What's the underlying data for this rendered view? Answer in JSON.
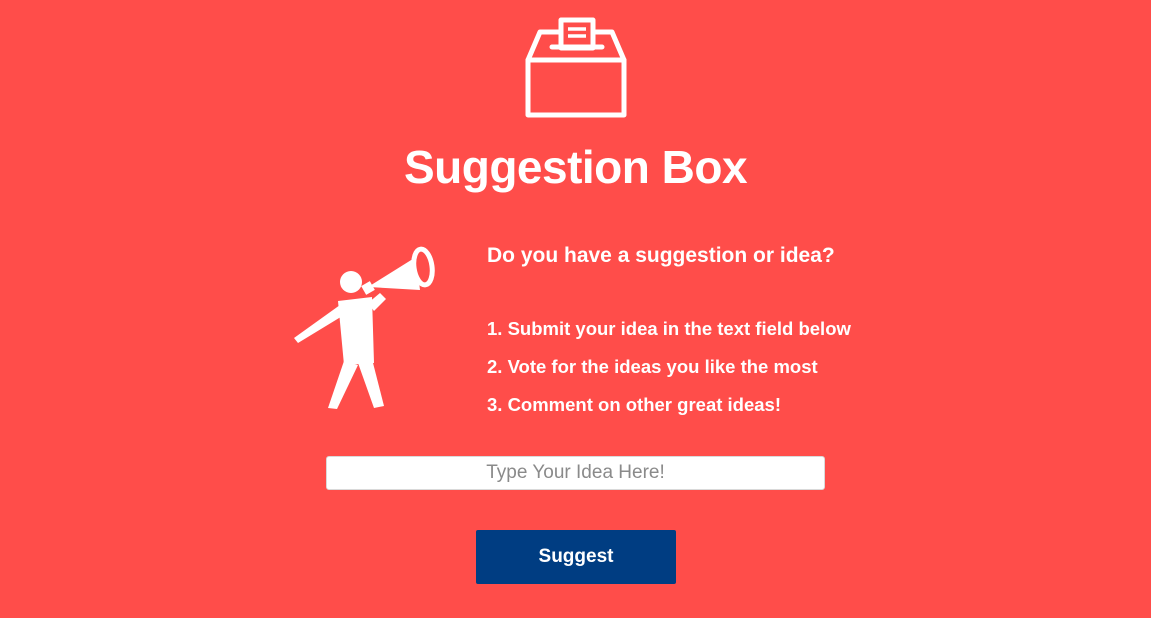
{
  "header": {
    "icon": "ballot-box-icon",
    "title": "Suggestion Box"
  },
  "illustration": {
    "icon": "megaphone-person-icon"
  },
  "intro": {
    "question": "Do you have a suggestion or idea?",
    "steps": [
      "1. Submit your idea in the text field below",
      "2. Vote for the ideas you like the most",
      "3. Comment on other great ideas!"
    ]
  },
  "form": {
    "idea_placeholder": "Type Your Idea Here!",
    "idea_value": "",
    "submit_label": "Suggest"
  },
  "colors": {
    "background": "#ff4d4a",
    "button": "#003d82",
    "text": "#ffffff"
  }
}
